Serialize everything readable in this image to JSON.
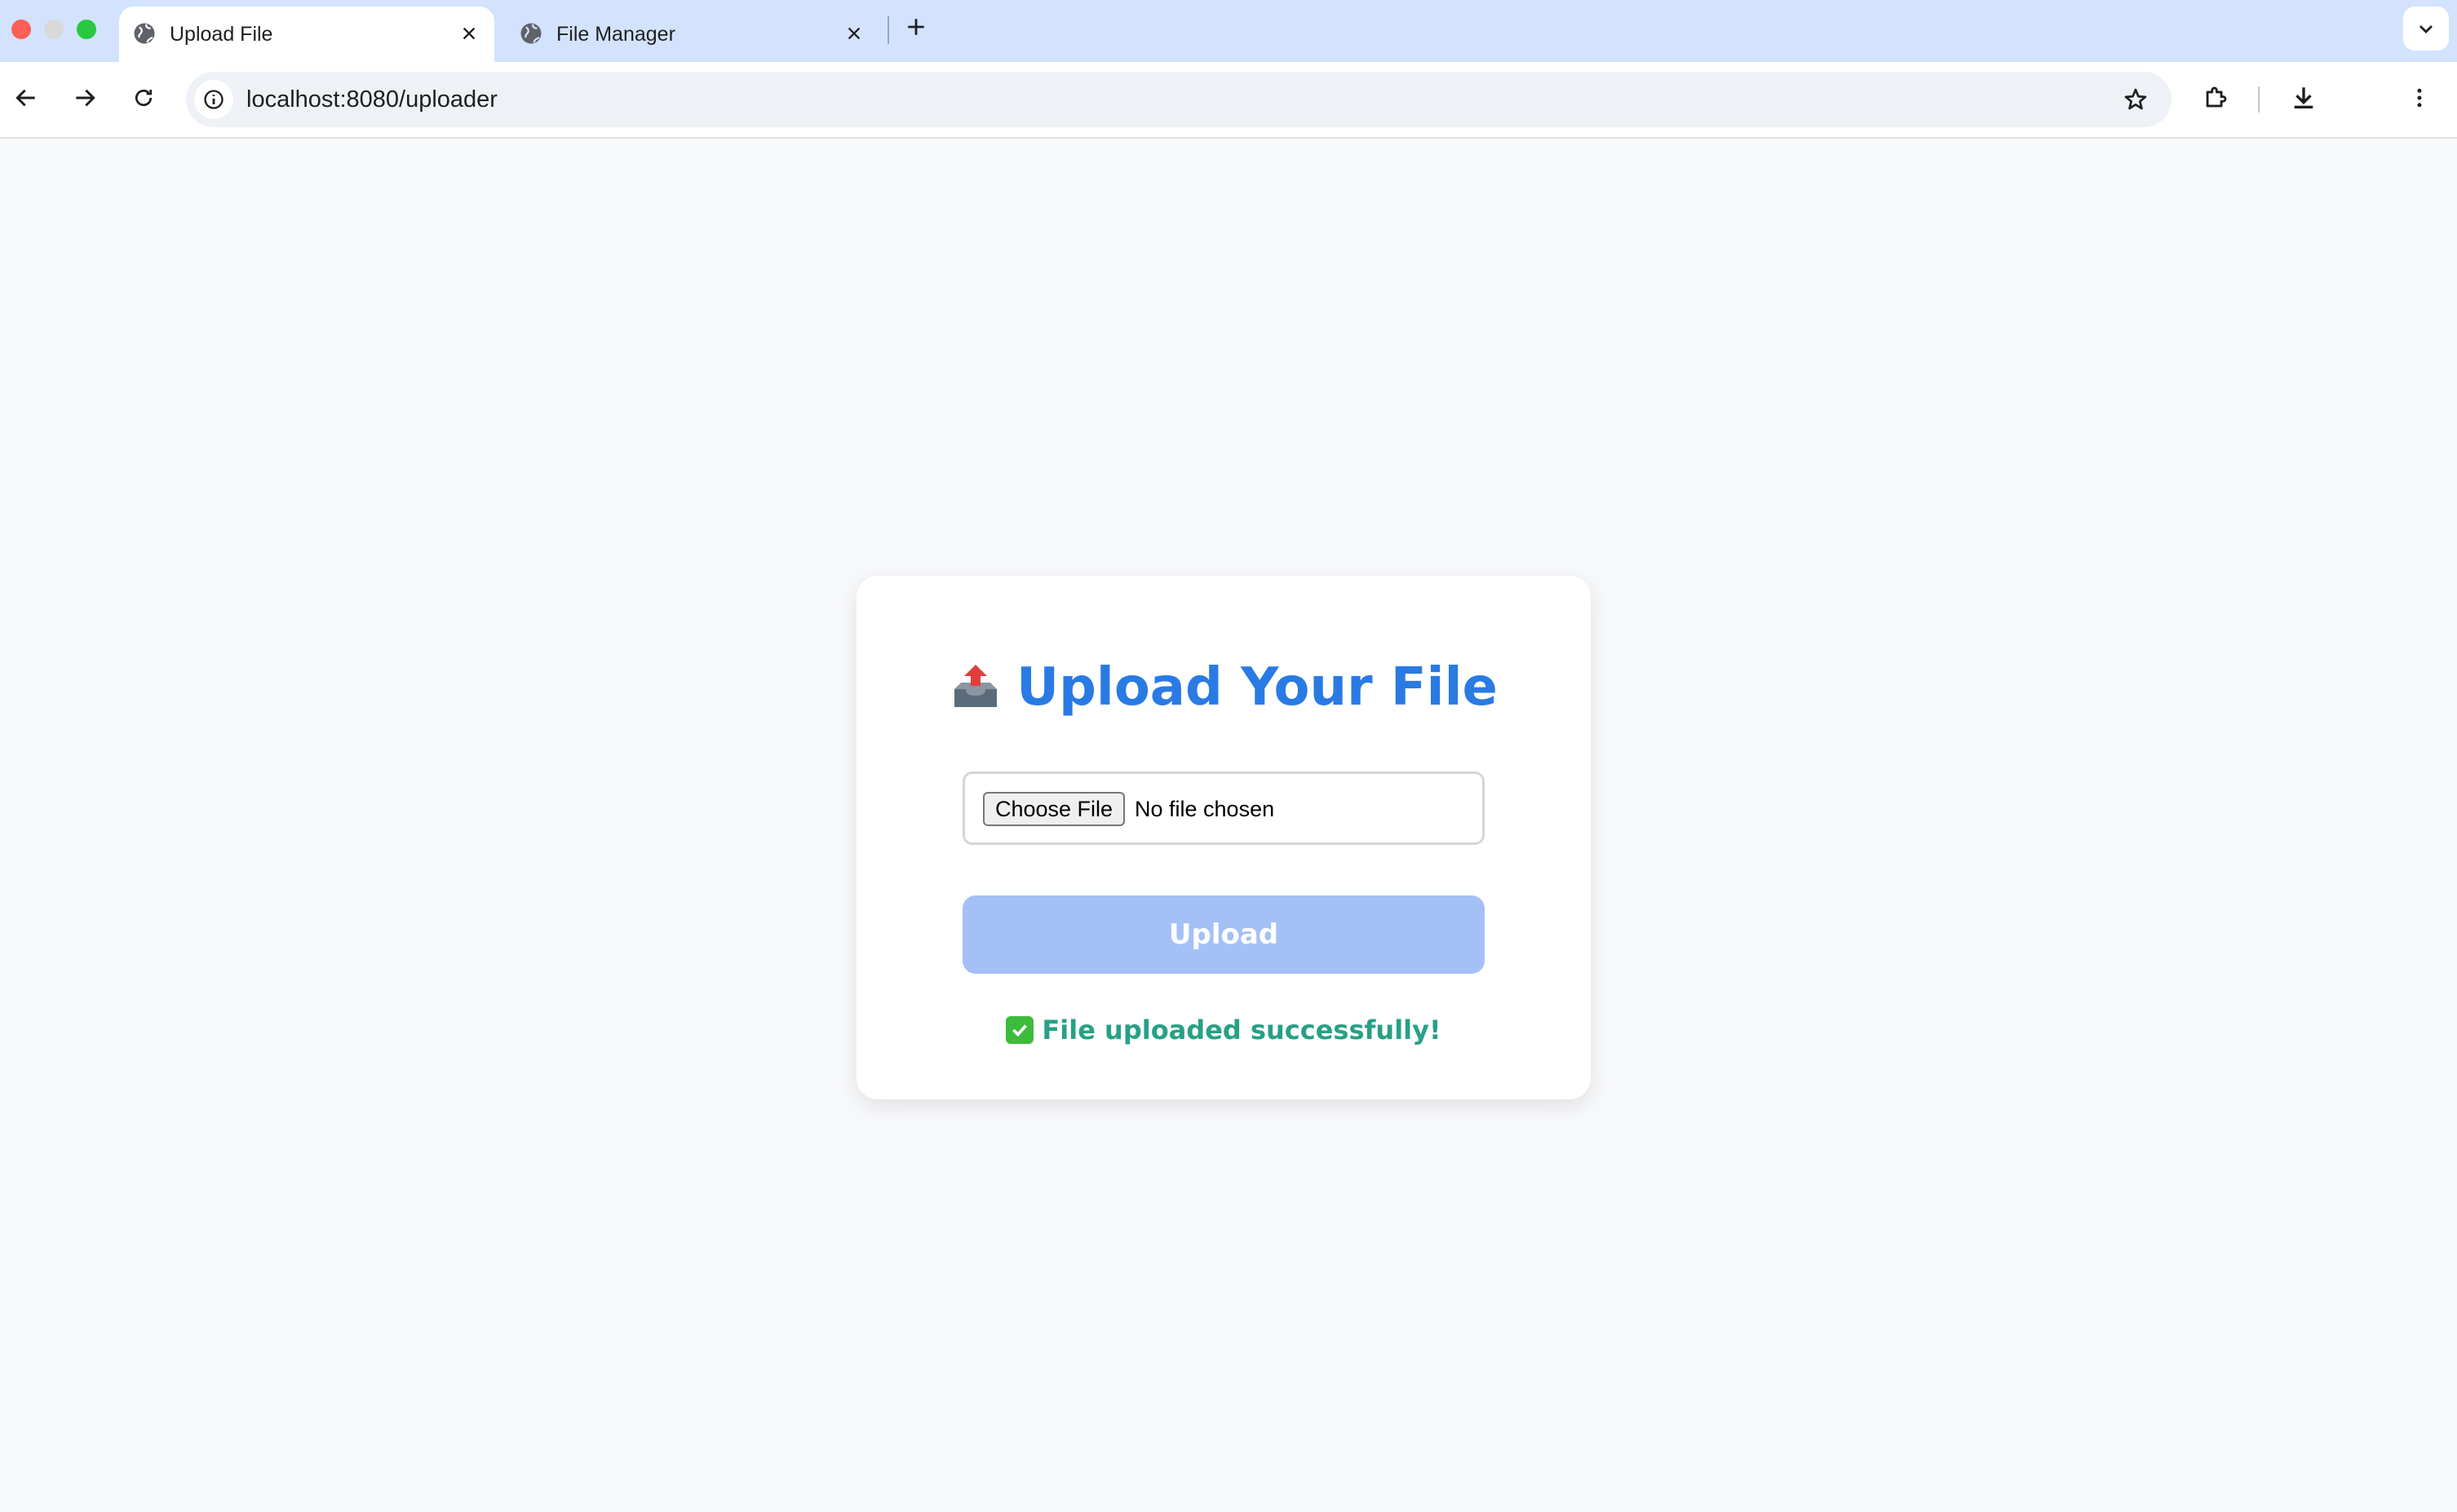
{
  "browser": {
    "tabs": [
      {
        "title": "Upload File",
        "active": true
      },
      {
        "title": "File Manager",
        "active": false
      }
    ],
    "address_bar": {
      "url": "localhost:8080/uploader"
    }
  },
  "page": {
    "heading": "Upload Your File",
    "heading_icon": "inbox-tray-icon",
    "file_input": {
      "button_label": "Choose File",
      "status_text": "No file chosen"
    },
    "upload_button_label": "Upload",
    "status_message": "File uploaded successfully!",
    "status_icon": "check-mark-button-icon"
  },
  "colors": {
    "heading": "#2a7ae4",
    "upload_button": "#a4c0f7",
    "success_text": "#27a086",
    "tab_strip": "#d3e3fd"
  }
}
